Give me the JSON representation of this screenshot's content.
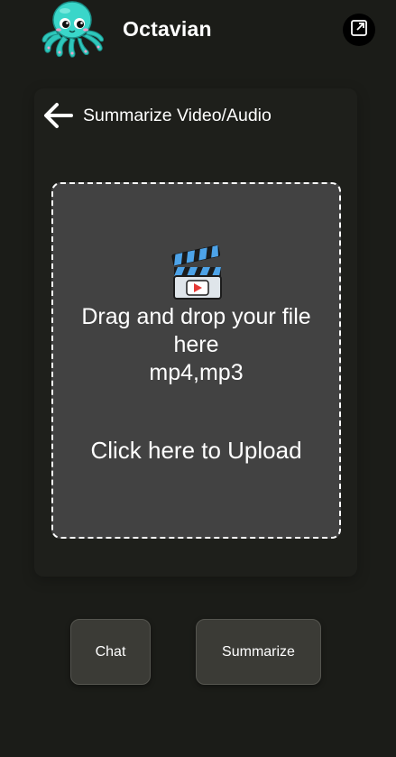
{
  "app": {
    "title": "Octavian",
    "logo_icon": "octopus-logo-icon",
    "open_external_icon": "open-external-icon"
  },
  "page": {
    "back_icon": "arrow-left-icon",
    "title": "Summarize Video/Audio"
  },
  "dropzone": {
    "icon": "clapperboard-icon",
    "line1": "Drag and drop your file",
    "line2": "here",
    "formats": "mp4,mp3",
    "upload_label": "Click here to Upload"
  },
  "actions": {
    "chat_label": "Chat",
    "summarize_label": "Summarize"
  },
  "colors": {
    "background": "#1b1c18",
    "dropzone": "#424242",
    "button": "#3b3b36",
    "octopus": "#3ad6c9"
  }
}
